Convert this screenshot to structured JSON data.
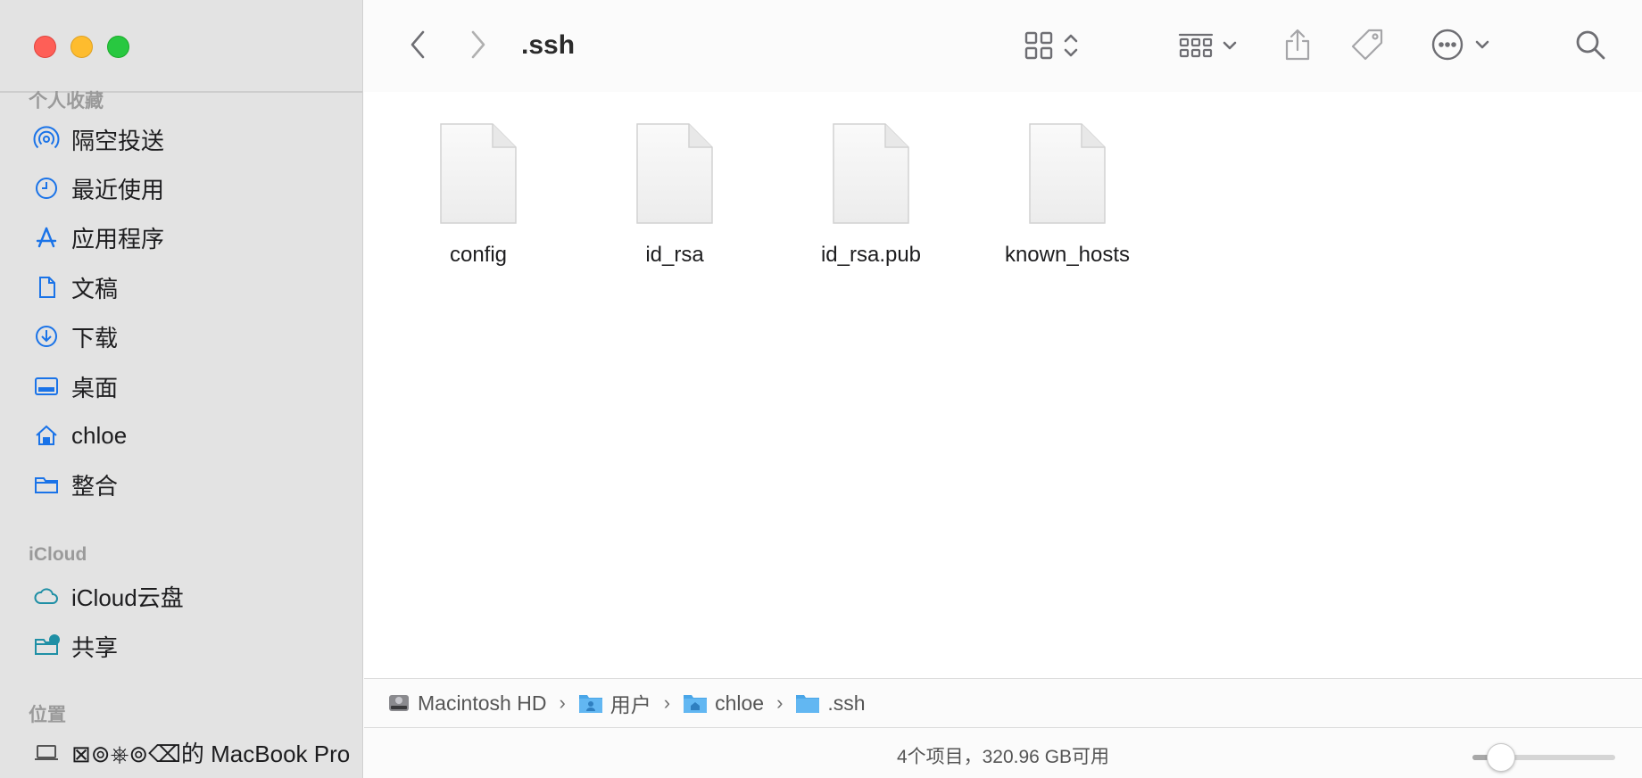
{
  "window": {
    "title": ".ssh"
  },
  "colors": {
    "accent": "#1a73e8",
    "sidebar_bg": "#e3e3e3",
    "icloud": "#1f8fa5"
  },
  "sidebar": {
    "favorites_title": "个人收藏",
    "favorites": [
      {
        "label": "隔空投送",
        "icon": "airdrop-icon"
      },
      {
        "label": "最近使用",
        "icon": "clock-icon"
      },
      {
        "label": "应用程序",
        "icon": "apps-icon"
      },
      {
        "label": "文稿",
        "icon": "document-icon"
      },
      {
        "label": "下载",
        "icon": "download-icon"
      },
      {
        "label": "桌面",
        "icon": "desktop-icon"
      },
      {
        "label": "chloe",
        "icon": "home-icon"
      },
      {
        "label": "整合",
        "icon": "folder-icon"
      }
    ],
    "icloud_title": "iCloud",
    "icloud": [
      {
        "label": "iCloud云盘",
        "icon": "cloud-icon"
      },
      {
        "label": "共享",
        "icon": "shared-folder-icon"
      }
    ],
    "locations_title": "位置",
    "locations": [
      {
        "label": "⊠⊚⎈⊚⌫的 MacBook Pro",
        "icon": "laptop-icon"
      }
    ]
  },
  "toolbar": {
    "icons": [
      "back-icon",
      "forward-icon",
      "grid-view-icon",
      "group-icon",
      "share-icon",
      "tag-icon",
      "more-icon",
      "search-icon"
    ]
  },
  "files": [
    {
      "name": "config"
    },
    {
      "name": "id_rsa"
    },
    {
      "name": "id_rsa.pub"
    },
    {
      "name": "known_hosts"
    }
  ],
  "pathbar": {
    "items": [
      {
        "label": "Macintosh HD",
        "icon": "hard-drive-icon"
      },
      {
        "label": "用户",
        "icon": "users-folder-icon"
      },
      {
        "label": "chloe",
        "icon": "home-folder-icon"
      },
      {
        "label": ".ssh",
        "icon": "folder-icon"
      }
    ]
  },
  "status": {
    "text": "4个项目，320.96 GB可用",
    "icon_size_level": 0.2
  }
}
